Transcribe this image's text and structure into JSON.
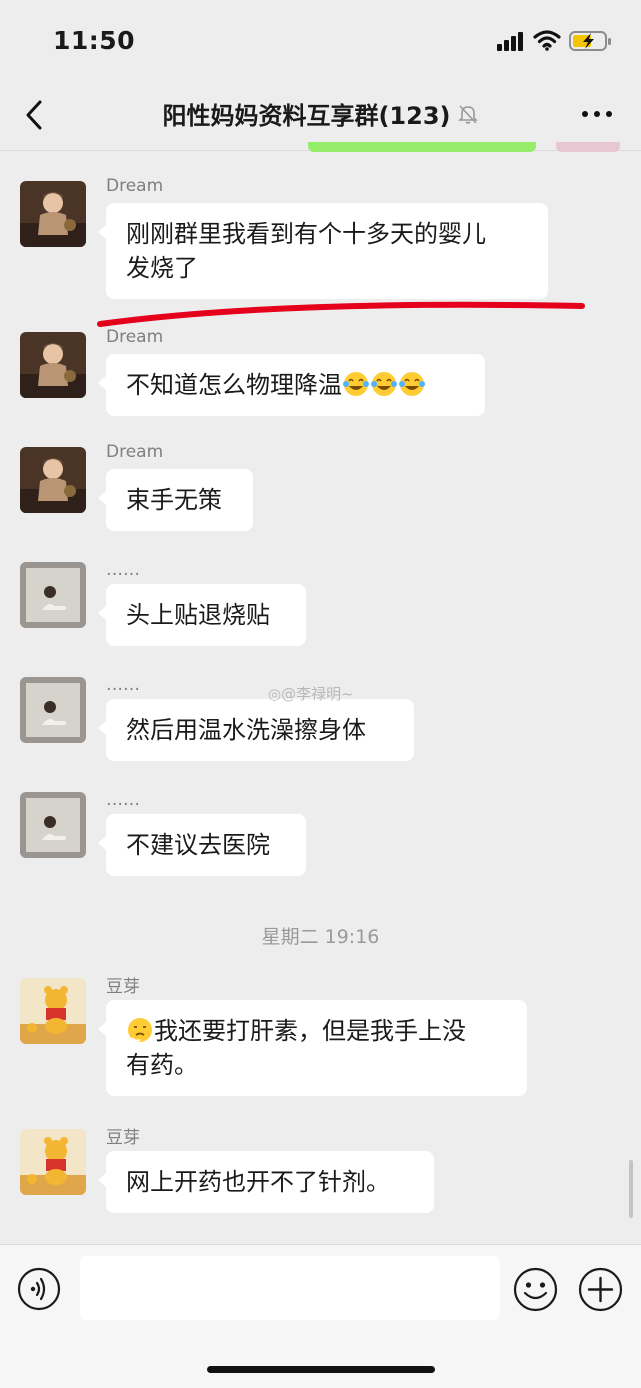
{
  "status": {
    "time": "11:50"
  },
  "header": {
    "title": "阳性妈妈资料互享群(123)"
  },
  "messages": [
    {
      "sender": "Dream",
      "line1": "刚刚群里我看到有个十多天的婴儿",
      "line2": "发烧了"
    },
    {
      "sender": "Dream",
      "text": "不知道怎么物理降温"
    },
    {
      "sender": "Dream",
      "text": "束手无策"
    },
    {
      "sender": "……",
      "text": "头上贴退烧贴"
    },
    {
      "sender": "……",
      "text": "然后用温水洗澡擦身体"
    },
    {
      "sender": "……",
      "text": "不建议去医院"
    },
    {
      "sender": "豆芽",
      "line1": "我还要打肝素，但是我手上没",
      "line2": "有药。"
    },
    {
      "sender": "豆芽",
      "text": "网上开药也开不了针剂。"
    }
  ],
  "timestamp": "星期二 19:16",
  "watermark": "@李禄明~",
  "input": {
    "value": ""
  },
  "icons": {
    "back": "chevron-left-icon",
    "mute": "bell-off-icon",
    "more": "more-icon",
    "voice": "voice-icon",
    "emoji": "emoji-icon",
    "plus": "plus-icon"
  },
  "colors": {
    "background": "#ededed",
    "bubble": "#ffffff",
    "annotation": "#e5001c",
    "self_bubble": "#95ec69"
  }
}
